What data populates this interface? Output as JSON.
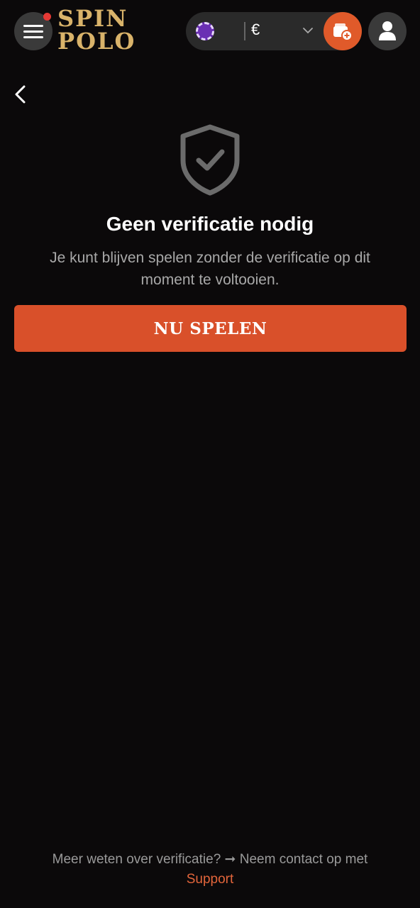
{
  "header": {
    "logo_line1": "SPIN",
    "logo_line2": "POLO",
    "currency": "€",
    "icons": {
      "menu": "hamburger-menu-icon",
      "notification": "notification-dot-icon",
      "chip": "casino-chip-icon",
      "dropdown": "chevron-down-icon",
      "wallet": "wallet-add-icon",
      "user": "user-icon"
    }
  },
  "nav": {
    "back_icon": "chevron-left-icon"
  },
  "main": {
    "icon": "shield-check-icon",
    "title": "Geen verificatie nodig",
    "subtitle": "Je kunt blijven spelen zonder de verificatie op dit moment te voltooien.",
    "cta_label": "NU SPELEN"
  },
  "footer": {
    "text": "Meer weten over verificatie? ➞ Neem contact op met",
    "link": "Support"
  },
  "colors": {
    "background": "#0b090a",
    "accent": "#d9502a",
    "logo_gold": "#d9b36a",
    "link": "#e2653b"
  }
}
